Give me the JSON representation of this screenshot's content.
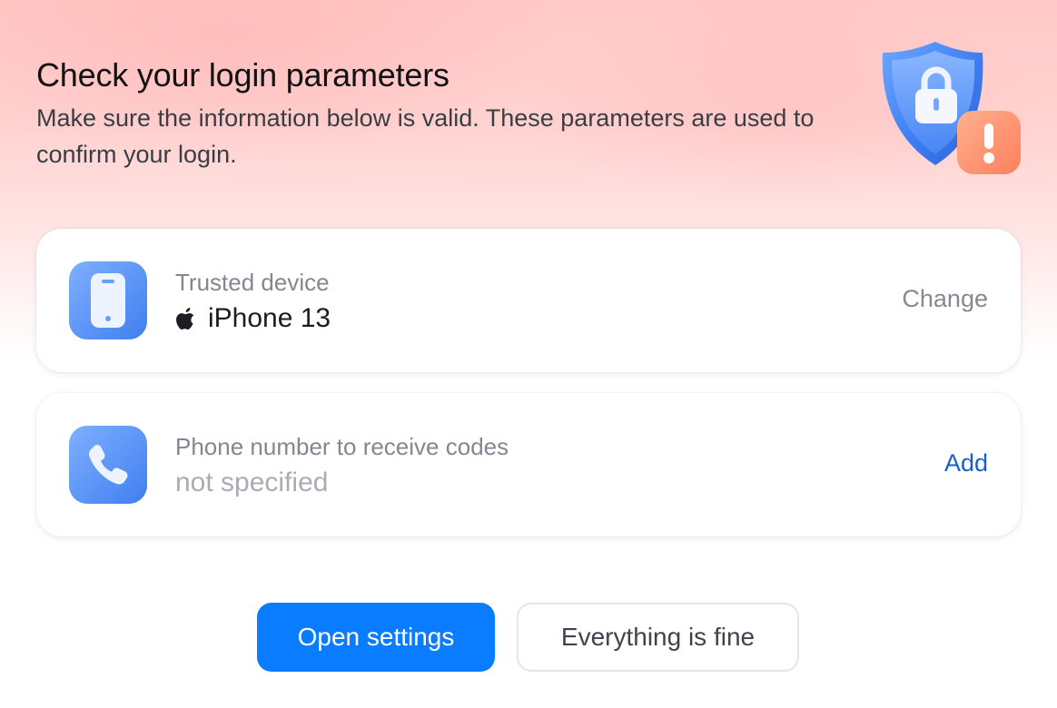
{
  "header": {
    "title": "Check your login parameters",
    "subtitle": "Make sure the information below is valid. These parameters are used to confirm your login.",
    "illustration_icon": "shield-lock-warning-icon"
  },
  "cards": {
    "device": {
      "icon": "smartphone-icon",
      "label": "Trusted device",
      "platform_icon": "apple-logo-icon",
      "value": "iPhone 13",
      "action": "Change"
    },
    "phone": {
      "icon": "phone-handset-icon",
      "label": "Phone number to receive codes",
      "value": "not specified",
      "action": "Add"
    }
  },
  "buttons": {
    "primary": "Open settings",
    "secondary": "Everything is fine"
  },
  "colors": {
    "accent": "#0a7cff",
    "link": "#1a5fc9",
    "header_gradient": "#ffc9c7",
    "warning": "#ff8f6b",
    "shield": "#3d7ef2"
  }
}
